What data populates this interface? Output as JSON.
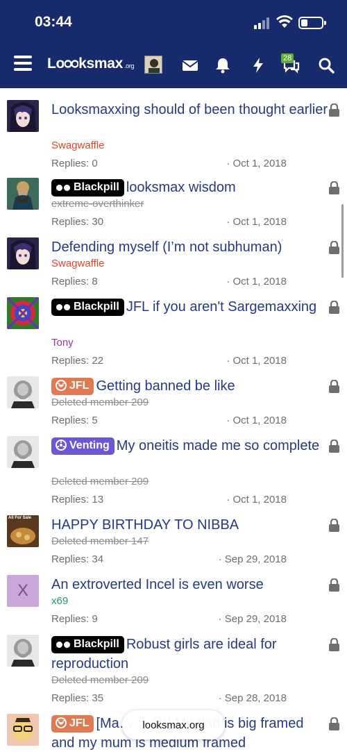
{
  "status_bar": {
    "time": "03:44"
  },
  "navbar": {
    "logo_text": "Lo",
    "logo_text2": "ksmax",
    "logo_suffix": ".org",
    "messages_badge": "28"
  },
  "threads": [
    {
      "prefix": "",
      "title": "Looksmaxxing should of been thought earlier",
      "author": "Swagwaffle",
      "author_color": "#e0452a",
      "author_deleted": false,
      "replies": "Replies: 0",
      "date": "Oct 1, 2018",
      "avatar": "anime"
    },
    {
      "prefix": "Blackpill",
      "title": "looksmax wisdom",
      "author": "extreme-overthinker",
      "author_color": "#8c8c8c",
      "author_deleted": true,
      "replies": "Replies: 30",
      "date": "Oct 1, 2018",
      "avatar": "painting"
    },
    {
      "prefix": "",
      "title": "Defending myself (I’m not subhuman)",
      "author": "Swagwaffle",
      "author_color": "#e0452a",
      "author_deleted": false,
      "replies": "Replies: 8",
      "date": "Oct 1, 2018",
      "avatar": "anime"
    },
    {
      "prefix": "Blackpill",
      "title": "JFL if you aren't Sargemaxxing",
      "author": "Tony",
      "author_color": "#a12ea8",
      "author_deleted": false,
      "replies": "Replies: 22",
      "date": "Oct 1, 2018",
      "avatar": "psych"
    },
    {
      "prefix": "JFL",
      "title": "Getting banned be like",
      "author": "Deleted member 209",
      "author_color": "#8c8c8c",
      "author_deleted": true,
      "replies": "Replies: 5",
      "date": "Oct 1, 2018",
      "avatar": "marx"
    },
    {
      "prefix": "Venting",
      "title": "My oneitis made me so complete",
      "author": "Deleted member 209",
      "author_color": "#8c8c8c",
      "author_deleted": true,
      "replies": "Replies: 13",
      "date": "Oct 1, 2018",
      "avatar": "marx"
    },
    {
      "prefix": "",
      "title": "HAPPY BIRTHDAY TO NIBBA",
      "author": "Deleted member 147",
      "author_color": "#8c8c8c",
      "author_deleted": true,
      "replies": "Replies: 34",
      "date": "Sep 29, 2018",
      "avatar": "sale",
      "avatar_text": "All For Sale"
    },
    {
      "prefix": "",
      "title": "An extroverted Incel is even worse",
      "author": "x69",
      "author_color": "#1f9a6b",
      "author_deleted": false,
      "replies": "Replies: 9",
      "date": "Sep 29, 2018",
      "avatar": "letter",
      "avatar_text": "X"
    },
    {
      "prefix": "Blackpill",
      "title": "Robust girls are ideal for reproduction",
      "author": "Deleted member 209",
      "author_color": "#8c8c8c",
      "author_deleted": true,
      "replies": "Replies: 35",
      "date": "Sep 28, 2018",
      "avatar": "marx"
    },
    {
      "prefix": "JFL",
      "title": "[Ma… …ert] My dad is big framed and my mum is medium framed",
      "author": "",
      "author_color": "#8c8c8c",
      "author_deleted": false,
      "replies": "",
      "date": "",
      "avatar": "cartoon"
    }
  ],
  "url_pill": "looksmax.org",
  "colors": {
    "navbar": "#172a6b",
    "link": "#233a8a",
    "blackpill": "#000000",
    "jfl": "#e07a52",
    "venting": "#6957d6"
  },
  "icons": [
    "hamburger-icon",
    "mail-icon",
    "bell-icon",
    "bolt-icon",
    "chat-icon",
    "search-icon",
    "lock-icon",
    "blackpill-icon",
    "jfl-icon",
    "venting-icon"
  ]
}
